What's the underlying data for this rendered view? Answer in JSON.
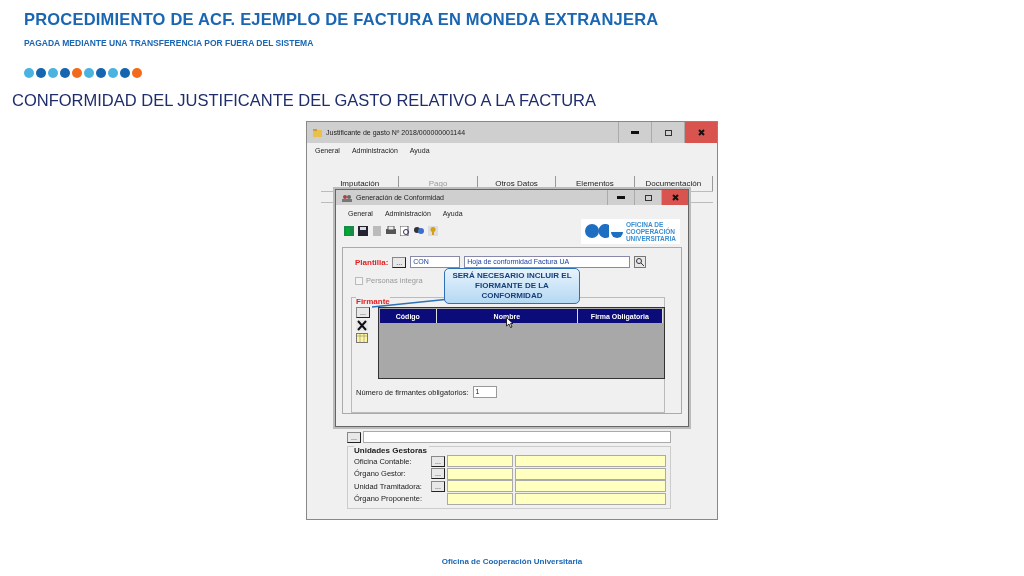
{
  "slide": {
    "title": "PROCEDIMIENTO DE ACF. EJEMPLO DE FACTURA EN MONEDA EXTRANJERA",
    "subtitle": "PAGADA MEDIANTE UNA TRANSFERENCIA POR FUERA DEL SISTEMA",
    "dots": [
      {
        "color": "#4ab3e0"
      },
      {
        "color": "#1565b0"
      },
      {
        "color": "#4ab3e0"
      },
      {
        "color": "#1565b0"
      },
      {
        "color": "#f26a1b"
      },
      {
        "color": "#4ab3e0"
      },
      {
        "color": "#1565b0"
      },
      {
        "color": "#4ab3e0"
      },
      {
        "color": "#1565b0"
      },
      {
        "color": "#f26a1b"
      }
    ],
    "heading": "CONFORMIDAD DEL JUSTIFICANTE DEL GASTO RELATIVO A LA FACTURA",
    "footer": "Oficina de Cooperación Universitaria"
  },
  "window": {
    "title": "Justificante de gasto Nº 2018/000000001144",
    "menu": [
      "General",
      "Administración",
      "Ayuda"
    ],
    "tabs": [
      {
        "label": "Imputación",
        "disabled": false
      },
      {
        "label": "Pago",
        "disabled": true
      },
      {
        "label": "Otros Datos",
        "disabled": false
      },
      {
        "label": "Elementos",
        "disabled": false
      },
      {
        "label": "Documentación",
        "disabled": false
      }
    ],
    "lower_button": "...",
    "unidades": {
      "title": "Unidades Gestoras",
      "rows": [
        {
          "label": "Oficina Contable:",
          "button": "..."
        },
        {
          "label": "Órgano Gestor:",
          "button": "..."
        },
        {
          "label": "Unidad Tramitadora:",
          "button": "..."
        },
        {
          "label": "Órgano Proponente:"
        }
      ]
    }
  },
  "dialog": {
    "title": "Generación de Conformidad",
    "menu": [
      "General",
      "Administración",
      "Ayuda"
    ],
    "logo": [
      "OFICINA DE",
      "COOPERACIÓN",
      "UNIVERSITARIA"
    ],
    "plantilla": {
      "label": "Plantilla:",
      "button": "...",
      "code": "CON",
      "name": "Hoja de conformidad Factura UA"
    },
    "checkbox": {
      "label": "Personas integra",
      "checked": false,
      "disabled": true
    },
    "firmante": {
      "title": "Firmante",
      "add_button": "...",
      "columns": [
        "Código",
        "Nombre",
        "Firma Obligatoria"
      ]
    },
    "count": {
      "label": "Número de firmantes obligatorios:",
      "value": "1"
    },
    "callout": "SERÁ NECESARIO INCLUIR EL FIORMANTE DE LA CONFORMIDAD"
  }
}
